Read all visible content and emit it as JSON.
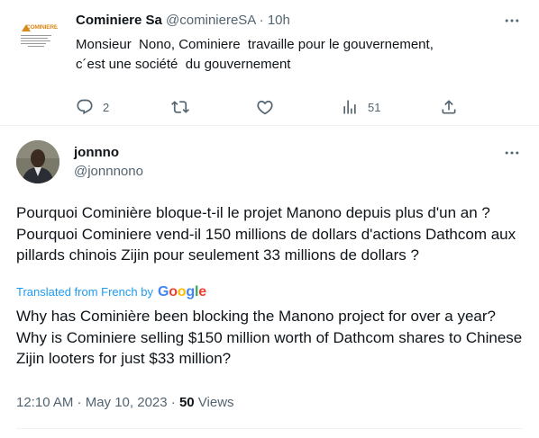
{
  "tweet1": {
    "author_name": "Cominiere Sa",
    "handle": "@cominiereSA",
    "separator": "·",
    "time": "10h",
    "logo_text": "COMINIERE SA",
    "text": "Monsieur  Nono, Cominiere  travaille pour le gouvernement,\nc´est une société  du gouvernement",
    "actions": {
      "reply_count": "2",
      "retweet_count": "",
      "like_count": "",
      "views_count": "51"
    }
  },
  "tweet2": {
    "author_name": "jonnno",
    "handle": "@jonnnono",
    "text": "Pourquoi Cominière bloque-t-il le projet Manono depuis plus d'un an ? Pourquoi Cominiere vend-il 150 millions de dollars d'actions Dathcom aux pillards chinois Zijin pour seulement 33 millions de dollars ?",
    "translated_label": "Translated from French by",
    "translation_provider": "Google",
    "translation": "Why has Cominière been blocking the Manono project for over a year? Why is Cominiere selling $150 million worth of Dathcom shares to Chinese Zijin looters for just $33 million?",
    "timestamp": "12:10 AM · May 10, 2023 · ",
    "views_count": "50",
    "views_label": " Views"
  },
  "colors": {
    "text_primary": "#0f1419",
    "text_secondary": "#536471",
    "link_blue": "#1d9bf0",
    "google_blue": "#4285f4",
    "google_red": "#ea4335",
    "google_yellow": "#fbbc05",
    "google_green": "#34a853"
  },
  "icons": [
    "more-icon",
    "reply-icon",
    "retweet-icon",
    "like-icon",
    "views-icon",
    "share-icon"
  ]
}
